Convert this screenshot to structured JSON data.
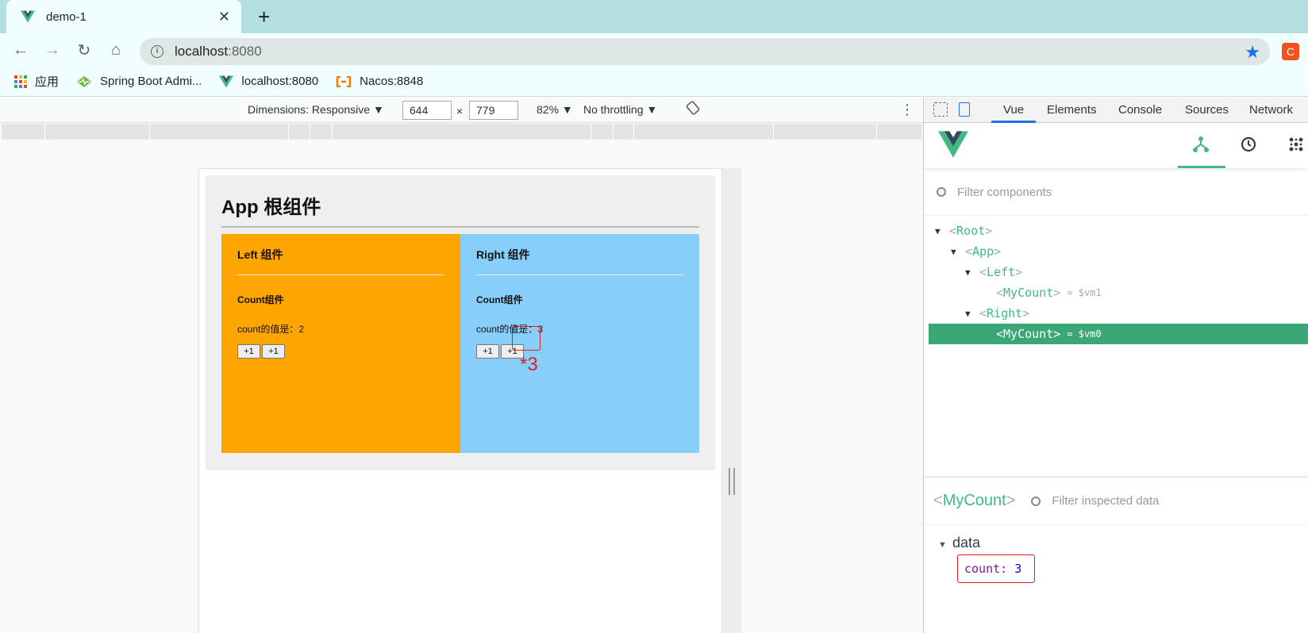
{
  "browser": {
    "tab_title": "demo-1",
    "tab_close": "✕",
    "new_tab": "+",
    "url_host": "localhost",
    "url_port": ":8080",
    "ext_letter": "C",
    "bookmarks": [
      {
        "label": "应用",
        "icon": "apps-grid-icon"
      },
      {
        "label": "Spring Boot Admi...",
        "icon": "heartbeat-icon"
      },
      {
        "label": "localhost:8080",
        "icon": "vue-logo-icon"
      },
      {
        "label": "Nacos:8848",
        "icon": "nacos-icon"
      }
    ]
  },
  "emulation": {
    "dimensions": "Dimensions: Responsive ▼",
    "width": "644",
    "times": "×",
    "height": "779",
    "zoom": "82% ▼",
    "throttling": "No throttling ▼"
  },
  "app": {
    "title": "App 根组件",
    "left": {
      "heading": "Left 组件",
      "count_heading": "Count组件",
      "count_line": "count的值是：2",
      "btn1": "+1",
      "btn2": "+1"
    },
    "right": {
      "heading": "Right 组件",
      "count_heading": "Count组件",
      "count_line": "count的值是：3",
      "btn1": "+1",
      "btn2": "+1"
    },
    "annotation": "*3"
  },
  "devtools": {
    "tabs": [
      "Vue",
      "Elements",
      "Console",
      "Sources",
      "Network"
    ],
    "active_tab": "Vue",
    "filter_placeholder": "Filter components",
    "tree": [
      {
        "name": "Root",
        "expanded": true
      },
      {
        "name": "App",
        "expanded": true
      },
      {
        "name": "Left",
        "expanded": true
      },
      {
        "name": "MyCount",
        "ref": "= $vm1"
      },
      {
        "name": "Right",
        "expanded": true
      },
      {
        "name": "MyCount",
        "ref": "= $vm0",
        "selected": true
      }
    ],
    "inspector": {
      "component": "MyCount",
      "filter_placeholder": "Filter inspected data",
      "section": "data",
      "key": "count",
      "value": "3"
    }
  },
  "colors": {
    "left_bg": "#ffa500",
    "right_bg": "#87cefa",
    "vue_green": "#42b983",
    "annotation_red": "#e02020"
  }
}
